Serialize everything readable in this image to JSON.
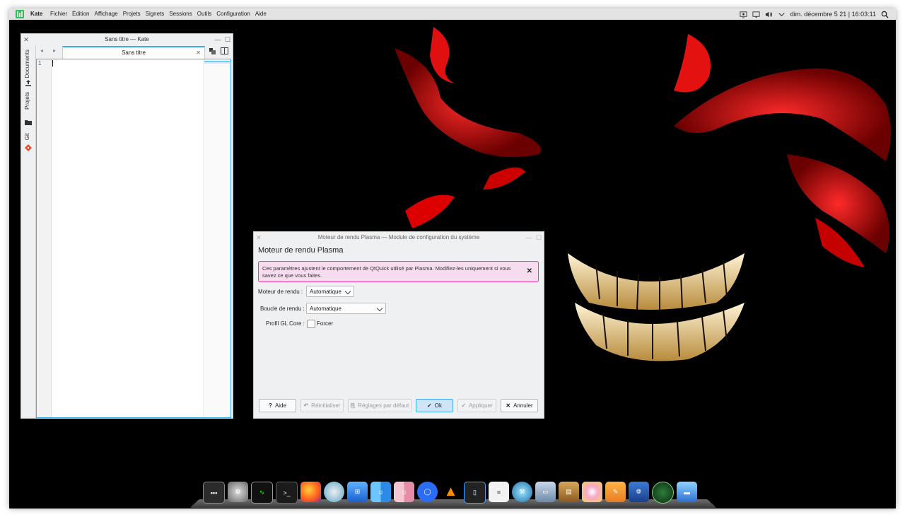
{
  "topbar": {
    "app_name": "Kate",
    "menus": [
      "Fichier",
      "Édition",
      "Affichage",
      "Projets",
      "Signets",
      "Sessions",
      "Outils",
      "Configuration",
      "Aide"
    ],
    "clock": "dim. décembre 5 21 | 16:03:11",
    "status_icons": [
      "screen-icon",
      "display-icon",
      "volume-icon",
      "chevron-down-icon",
      "search-icon"
    ]
  },
  "kate": {
    "window_title": "Sans titre — Kate",
    "sidebar_tabs": [
      "Documents",
      "Projets",
      "Git"
    ],
    "tab_label": "Sans titre",
    "line_number": "1"
  },
  "dialog": {
    "window_title": "Moteur de rendu Plasma — Module de configuration du système",
    "heading": "Moteur de rendu Plasma",
    "message": "Ces paramètres ajustent le comportement de QtQuick utilisé par Plasma. Modifiez-les uniquement si vous savez ce que vous faites.",
    "render_engine_label": "Moteur de rendu :",
    "render_engine_value": "Automatique",
    "render_loop_label": "Boucle de rendu :",
    "render_loop_value": "Automatique",
    "gl_profile_label": "Profil GL Core :",
    "gl_profile_checkbox": "Forcer",
    "buttons": {
      "help": "Aide",
      "reset": "Réinitialiser",
      "defaults": "Réglages par défaut",
      "ok": "Ok",
      "apply": "Appliquer",
      "cancel": "Annuler"
    }
  },
  "dock": {
    "icons": [
      "system-monitor-icon",
      "settings-icon",
      "activity-monitor-icon",
      "terminal-icon",
      "firefox-icon",
      "disk-utility-icon",
      "app-store-icon",
      "finder-icon",
      "finder-alt-icon",
      "signal-icon",
      "vlc-icon",
      "phone-icon",
      "notes-icon",
      "xcode-icon",
      "preview-icon",
      "archive-icon",
      "photos-icon",
      "pages-icon",
      "network-icon",
      "radar-icon",
      "desktop-icon"
    ]
  }
}
